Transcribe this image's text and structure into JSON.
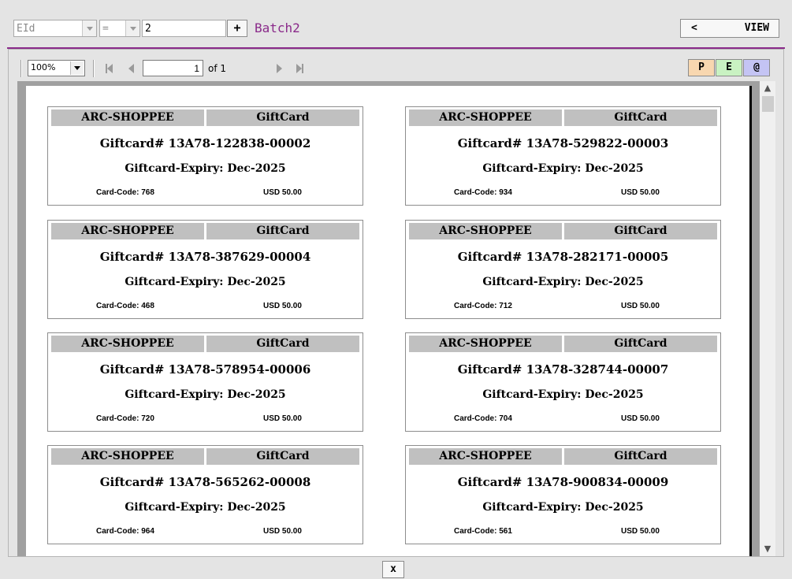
{
  "filter": {
    "field_value": "EId",
    "operator_value": "=",
    "value": "2",
    "add_label": "+",
    "batch_label": "Batch2",
    "view_arrow": "<",
    "view_label": "VIEW"
  },
  "viewer": {
    "zoom": "100%",
    "page_current": "1",
    "page_total_label": "of 1",
    "export_buttons": [
      {
        "label": "P",
        "color": "#f8d7b0"
      },
      {
        "label": "E",
        "color": "#c9f2c2"
      },
      {
        "label": "@",
        "color": "#c4c4f4"
      }
    ]
  },
  "cards": [
    {
      "store": "ARC-SHOPPEE",
      "type": "GiftCard",
      "number": "Giftcard# 13A78-122838-00002",
      "expiry": "Giftcard-Expiry: Dec-2025",
      "code": "Card-Code: 768",
      "amount": "USD 50.00"
    },
    {
      "store": "ARC-SHOPPEE",
      "type": "GiftCard",
      "number": "Giftcard# 13A78-529822-00003",
      "expiry": "Giftcard-Expiry: Dec-2025",
      "code": "Card-Code: 934",
      "amount": "USD 50.00"
    },
    {
      "store": "ARC-SHOPPEE",
      "type": "GiftCard",
      "number": "Giftcard# 13A78-387629-00004",
      "expiry": "Giftcard-Expiry: Dec-2025",
      "code": "Card-Code: 468",
      "amount": "USD 50.00"
    },
    {
      "store": "ARC-SHOPPEE",
      "type": "GiftCard",
      "number": "Giftcard# 13A78-282171-00005",
      "expiry": "Giftcard-Expiry: Dec-2025",
      "code": "Card-Code: 712",
      "amount": "USD 50.00"
    },
    {
      "store": "ARC-SHOPPEE",
      "type": "GiftCard",
      "number": "Giftcard# 13A78-578954-00006",
      "expiry": "Giftcard-Expiry: Dec-2025",
      "code": "Card-Code: 720",
      "amount": "USD 50.00"
    },
    {
      "store": "ARC-SHOPPEE",
      "type": "GiftCard",
      "number": "Giftcard# 13A78-328744-00007",
      "expiry": "Giftcard-Expiry: Dec-2025",
      "code": "Card-Code: 704",
      "amount": "USD 50.00"
    },
    {
      "store": "ARC-SHOPPEE",
      "type": "GiftCard",
      "number": "Giftcard# 13A78-565262-00008",
      "expiry": "Giftcard-Expiry: Dec-2025",
      "code": "Card-Code: 964",
      "amount": "USD 50.00"
    },
    {
      "store": "ARC-SHOPPEE",
      "type": "GiftCard",
      "number": "Giftcard# 13A78-900834-00009",
      "expiry": "Giftcard-Expiry: Dec-2025",
      "code": "Card-Code: 561",
      "amount": "USD 50.00"
    }
  ],
  "close_label": "x",
  "colors": {
    "accent": "#8a2a8a"
  }
}
